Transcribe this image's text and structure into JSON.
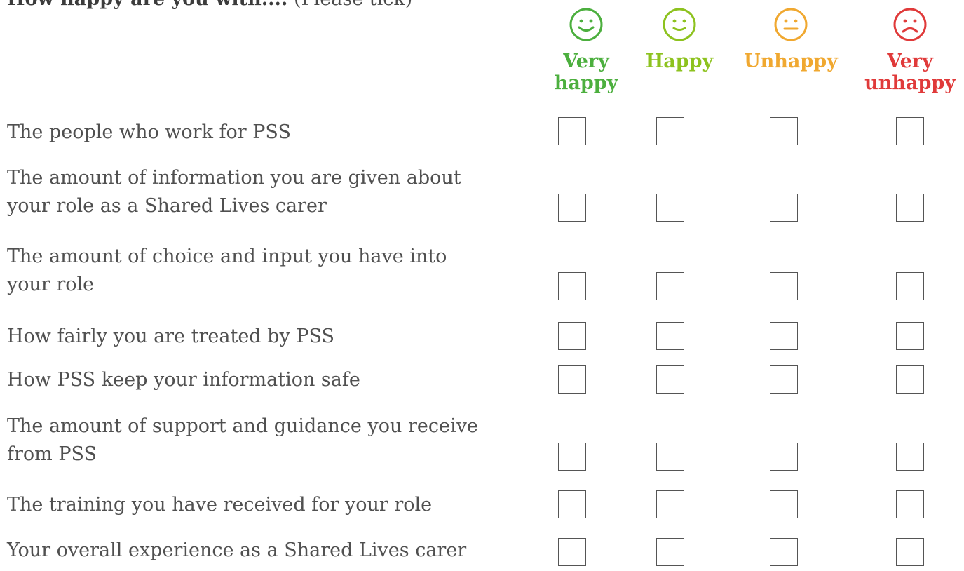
{
  "question": {
    "title": "How happy are you with....",
    "note": "(Please tick)"
  },
  "scale": [
    {
      "label": "Very happy",
      "line1": "Very",
      "line2": "happy",
      "color": "#4caf3e",
      "icon": "very-happy-face-icon"
    },
    {
      "label": "Happy",
      "line1": "Happy",
      "line2": "",
      "color": "#8dc21f",
      "icon": "happy-face-icon"
    },
    {
      "label": "Unhappy",
      "line1": "Unhappy",
      "line2": "",
      "color": "#f0a830",
      "icon": "neutral-face-icon"
    },
    {
      "label": "Very unhappy",
      "line1": "Very",
      "line2": "unhappy",
      "color": "#e03a3a",
      "icon": "sad-face-icon"
    }
  ],
  "rows": [
    {
      "line1": "The people who work for PSS",
      "line2": ""
    },
    {
      "line1": "The amount of information you are given about",
      "line2": "your role as a Shared Lives carer"
    },
    {
      "line1": "The amount of choice and input you have into",
      "line2": "your role"
    },
    {
      "line1": "How fairly you are treated by PSS",
      "line2": ""
    },
    {
      "line1": "How PSS keep your information safe",
      "line2": ""
    },
    {
      "line1": "The amount of support and guidance you receive",
      "line2": "from PSS"
    },
    {
      "line1": "The training you have received for your role",
      "line2": ""
    },
    {
      "line1": "Your overall experience as a Shared Lives carer",
      "line2": ""
    }
  ]
}
